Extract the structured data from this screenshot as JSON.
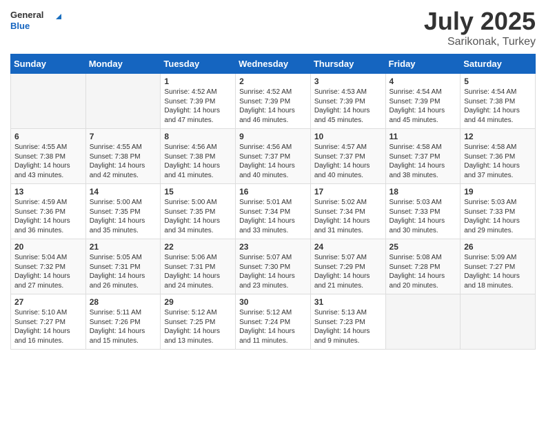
{
  "header": {
    "logo_general": "General",
    "logo_blue": "Blue",
    "title": "July 2025",
    "location": "Sarikonak, Turkey"
  },
  "weekdays": [
    "Sunday",
    "Monday",
    "Tuesday",
    "Wednesday",
    "Thursday",
    "Friday",
    "Saturday"
  ],
  "weeks": [
    [
      {
        "day": "",
        "sunrise": "",
        "sunset": "",
        "daylight": ""
      },
      {
        "day": "",
        "sunrise": "",
        "sunset": "",
        "daylight": ""
      },
      {
        "day": "1",
        "sunrise": "Sunrise: 4:52 AM",
        "sunset": "Sunset: 7:39 PM",
        "daylight": "Daylight: 14 hours and 47 minutes."
      },
      {
        "day": "2",
        "sunrise": "Sunrise: 4:52 AM",
        "sunset": "Sunset: 7:39 PM",
        "daylight": "Daylight: 14 hours and 46 minutes."
      },
      {
        "day": "3",
        "sunrise": "Sunrise: 4:53 AM",
        "sunset": "Sunset: 7:39 PM",
        "daylight": "Daylight: 14 hours and 45 minutes."
      },
      {
        "day": "4",
        "sunrise": "Sunrise: 4:54 AM",
        "sunset": "Sunset: 7:39 PM",
        "daylight": "Daylight: 14 hours and 45 minutes."
      },
      {
        "day": "5",
        "sunrise": "Sunrise: 4:54 AM",
        "sunset": "Sunset: 7:38 PM",
        "daylight": "Daylight: 14 hours and 44 minutes."
      }
    ],
    [
      {
        "day": "6",
        "sunrise": "Sunrise: 4:55 AM",
        "sunset": "Sunset: 7:38 PM",
        "daylight": "Daylight: 14 hours and 43 minutes."
      },
      {
        "day": "7",
        "sunrise": "Sunrise: 4:55 AM",
        "sunset": "Sunset: 7:38 PM",
        "daylight": "Daylight: 14 hours and 42 minutes."
      },
      {
        "day": "8",
        "sunrise": "Sunrise: 4:56 AM",
        "sunset": "Sunset: 7:38 PM",
        "daylight": "Daylight: 14 hours and 41 minutes."
      },
      {
        "day": "9",
        "sunrise": "Sunrise: 4:56 AM",
        "sunset": "Sunset: 7:37 PM",
        "daylight": "Daylight: 14 hours and 40 minutes."
      },
      {
        "day": "10",
        "sunrise": "Sunrise: 4:57 AM",
        "sunset": "Sunset: 7:37 PM",
        "daylight": "Daylight: 14 hours and 40 minutes."
      },
      {
        "day": "11",
        "sunrise": "Sunrise: 4:58 AM",
        "sunset": "Sunset: 7:37 PM",
        "daylight": "Daylight: 14 hours and 38 minutes."
      },
      {
        "day": "12",
        "sunrise": "Sunrise: 4:58 AM",
        "sunset": "Sunset: 7:36 PM",
        "daylight": "Daylight: 14 hours and 37 minutes."
      }
    ],
    [
      {
        "day": "13",
        "sunrise": "Sunrise: 4:59 AM",
        "sunset": "Sunset: 7:36 PM",
        "daylight": "Daylight: 14 hours and 36 minutes."
      },
      {
        "day": "14",
        "sunrise": "Sunrise: 5:00 AM",
        "sunset": "Sunset: 7:35 PM",
        "daylight": "Daylight: 14 hours and 35 minutes."
      },
      {
        "day": "15",
        "sunrise": "Sunrise: 5:00 AM",
        "sunset": "Sunset: 7:35 PM",
        "daylight": "Daylight: 14 hours and 34 minutes."
      },
      {
        "day": "16",
        "sunrise": "Sunrise: 5:01 AM",
        "sunset": "Sunset: 7:34 PM",
        "daylight": "Daylight: 14 hours and 33 minutes."
      },
      {
        "day": "17",
        "sunrise": "Sunrise: 5:02 AM",
        "sunset": "Sunset: 7:34 PM",
        "daylight": "Daylight: 14 hours and 31 minutes."
      },
      {
        "day": "18",
        "sunrise": "Sunrise: 5:03 AM",
        "sunset": "Sunset: 7:33 PM",
        "daylight": "Daylight: 14 hours and 30 minutes."
      },
      {
        "day": "19",
        "sunrise": "Sunrise: 5:03 AM",
        "sunset": "Sunset: 7:33 PM",
        "daylight": "Daylight: 14 hours and 29 minutes."
      }
    ],
    [
      {
        "day": "20",
        "sunrise": "Sunrise: 5:04 AM",
        "sunset": "Sunset: 7:32 PM",
        "daylight": "Daylight: 14 hours and 27 minutes."
      },
      {
        "day": "21",
        "sunrise": "Sunrise: 5:05 AM",
        "sunset": "Sunset: 7:31 PM",
        "daylight": "Daylight: 14 hours and 26 minutes."
      },
      {
        "day": "22",
        "sunrise": "Sunrise: 5:06 AM",
        "sunset": "Sunset: 7:31 PM",
        "daylight": "Daylight: 14 hours and 24 minutes."
      },
      {
        "day": "23",
        "sunrise": "Sunrise: 5:07 AM",
        "sunset": "Sunset: 7:30 PM",
        "daylight": "Daylight: 14 hours and 23 minutes."
      },
      {
        "day": "24",
        "sunrise": "Sunrise: 5:07 AM",
        "sunset": "Sunset: 7:29 PM",
        "daylight": "Daylight: 14 hours and 21 minutes."
      },
      {
        "day": "25",
        "sunrise": "Sunrise: 5:08 AM",
        "sunset": "Sunset: 7:28 PM",
        "daylight": "Daylight: 14 hours and 20 minutes."
      },
      {
        "day": "26",
        "sunrise": "Sunrise: 5:09 AM",
        "sunset": "Sunset: 7:27 PM",
        "daylight": "Daylight: 14 hours and 18 minutes."
      }
    ],
    [
      {
        "day": "27",
        "sunrise": "Sunrise: 5:10 AM",
        "sunset": "Sunset: 7:27 PM",
        "daylight": "Daylight: 14 hours and 16 minutes."
      },
      {
        "day": "28",
        "sunrise": "Sunrise: 5:11 AM",
        "sunset": "Sunset: 7:26 PM",
        "daylight": "Daylight: 14 hours and 15 minutes."
      },
      {
        "day": "29",
        "sunrise": "Sunrise: 5:12 AM",
        "sunset": "Sunset: 7:25 PM",
        "daylight": "Daylight: 14 hours and 13 minutes."
      },
      {
        "day": "30",
        "sunrise": "Sunrise: 5:12 AM",
        "sunset": "Sunset: 7:24 PM",
        "daylight": "Daylight: 14 hours and 11 minutes."
      },
      {
        "day": "31",
        "sunrise": "Sunrise: 5:13 AM",
        "sunset": "Sunset: 7:23 PM",
        "daylight": "Daylight: 14 hours and 9 minutes."
      },
      {
        "day": "",
        "sunrise": "",
        "sunset": "",
        "daylight": ""
      },
      {
        "day": "",
        "sunrise": "",
        "sunset": "",
        "daylight": ""
      }
    ]
  ]
}
